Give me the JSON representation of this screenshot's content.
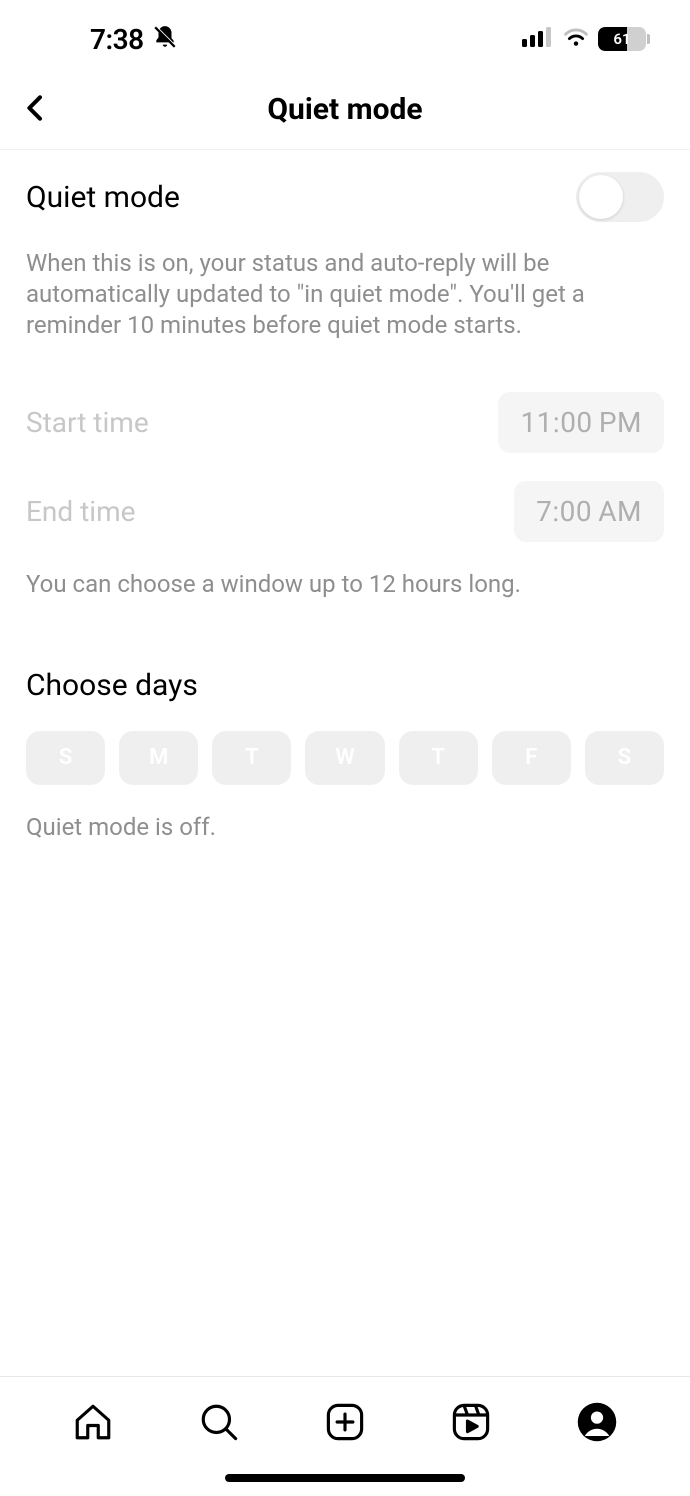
{
  "statusBar": {
    "time": "7:38",
    "battery": "61"
  },
  "header": {
    "title": "Quiet mode"
  },
  "toggle": {
    "label": "Quiet mode",
    "description": "When this is on, your status and auto-reply will be automatically updated to \"in quiet mode\". You'll get a reminder 10 minutes before quiet mode starts."
  },
  "times": {
    "startLabel": "Start time",
    "startValue": "11:00 PM",
    "endLabel": "End time",
    "endValue": "7:00 AM",
    "hint": "You can choose a window up to 12 hours long."
  },
  "days": {
    "title": "Choose days",
    "items": [
      "S",
      "M",
      "T",
      "W",
      "T",
      "F",
      "S"
    ],
    "status": "Quiet mode is off."
  }
}
